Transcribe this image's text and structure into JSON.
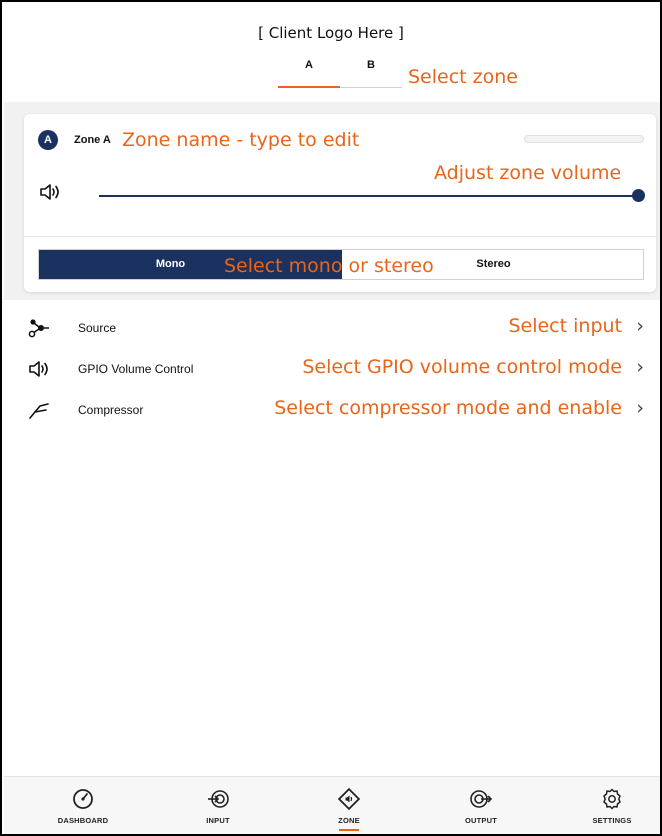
{
  "header": {
    "logo_text": "[ Client Logo Here ]",
    "zone_tabs": [
      {
        "label": "A",
        "active": true
      },
      {
        "label": "B",
        "active": false
      }
    ]
  },
  "annotations": {
    "select_zone": "Select zone",
    "zone_name": "Zone name - type to edit",
    "adjust_volume": "Adjust zone volume",
    "mono_stereo": "Select mono or stereo",
    "select_input": "Select input",
    "gpio": "Select GPIO volume control mode",
    "compressor": "Select compressor mode and enable"
  },
  "zone_card": {
    "avatar_letter": "A",
    "zone_name": "Zone A",
    "volume_percent": 100,
    "mode": {
      "mono_label": "Mono",
      "stereo_label": "Stereo",
      "selected": "Mono"
    }
  },
  "settings_list": [
    {
      "label": "Source",
      "icon": "source-icon"
    },
    {
      "label": "GPIO Volume Control",
      "icon": "speaker-icon"
    },
    {
      "label": "Compressor",
      "icon": "compressor-icon"
    }
  ],
  "bottom_nav": [
    {
      "label": "DASHBOARD",
      "icon": "dashboard-icon",
      "active": false
    },
    {
      "label": "INPUT",
      "icon": "input-icon",
      "active": false
    },
    {
      "label": "ZONE",
      "icon": "zone-icon",
      "active": true
    },
    {
      "label": "OUTPUT",
      "icon": "output-icon",
      "active": false
    },
    {
      "label": "SETTINGS",
      "icon": "settings-icon",
      "active": false
    }
  ],
  "colors": {
    "accent": "#e8651a",
    "navy": "#1b3260"
  }
}
